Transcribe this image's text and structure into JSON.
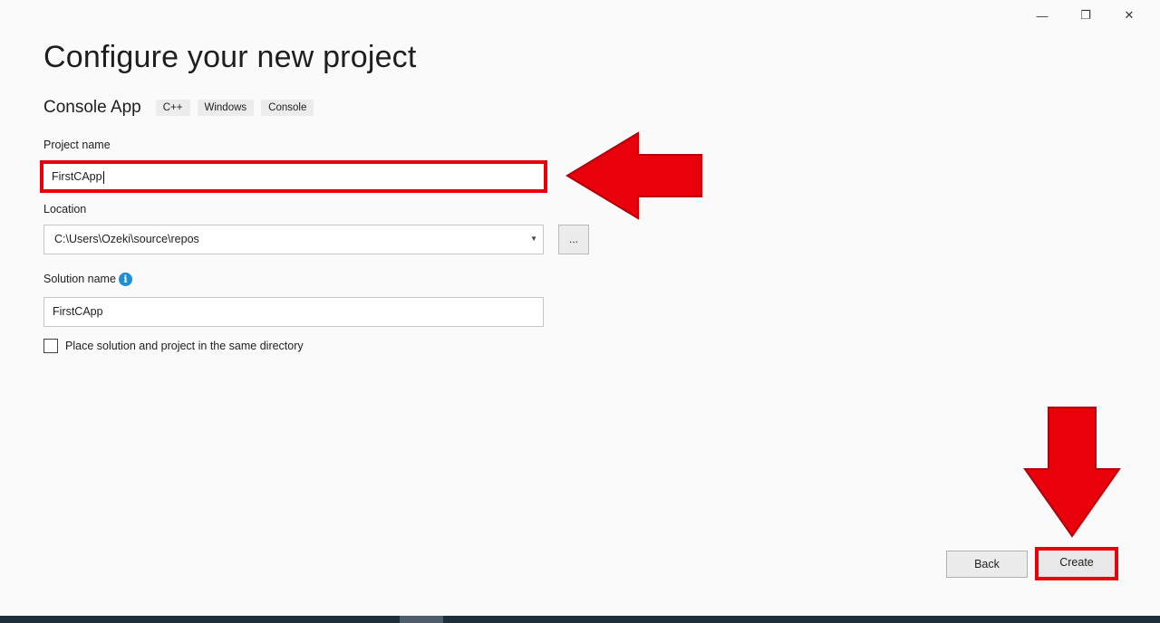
{
  "window_controls": {
    "minimize": "—",
    "restore": "❐",
    "close": "✕"
  },
  "page_title": "Configure your new project",
  "template": {
    "name": "Console App",
    "tags": [
      "C++",
      "Windows",
      "Console"
    ]
  },
  "project_name": {
    "label": "Project name",
    "value": "FirstCApp"
  },
  "location": {
    "label": "Location",
    "value": "C:\\Users\\Ozeki\\source\\repos",
    "browse_label": "..."
  },
  "solution_name": {
    "label": "Solution name",
    "value": "FirstCApp",
    "info_icon": "i"
  },
  "same_directory": {
    "label": "Place solution and project in the same directory",
    "checked": false
  },
  "buttons": {
    "back": "Back",
    "create": "Create"
  },
  "colors": {
    "highlight": "#e8000b",
    "info_icon": "#1b8fd6"
  }
}
